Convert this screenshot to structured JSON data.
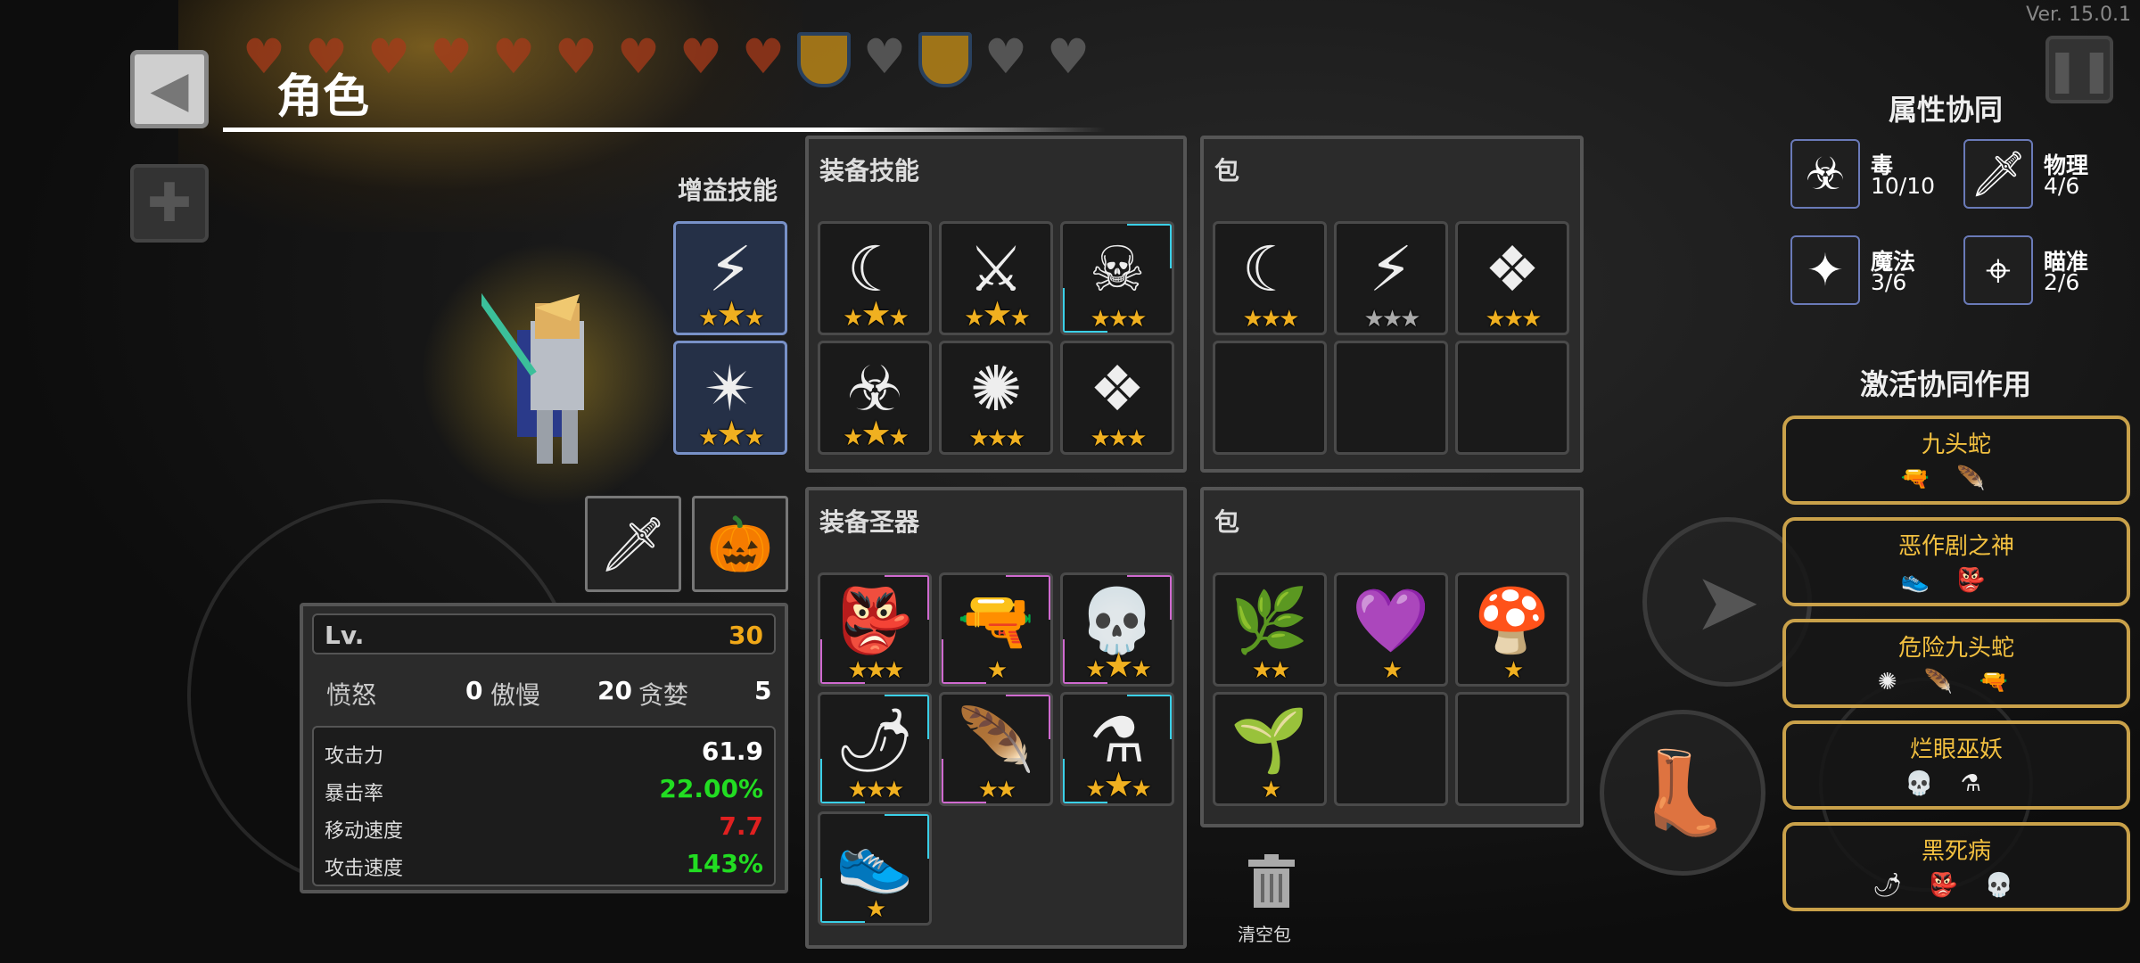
{
  "version": "Ver. 15.0.1",
  "hud": {
    "full_hearts": 9,
    "hearts": [
      "heart",
      "heart",
      "heart",
      "heart",
      "heart",
      "heart",
      "heart",
      "heart",
      "heart"
    ],
    "shields": [
      "shield",
      "armor",
      "shield",
      "armor",
      "armor"
    ]
  },
  "header": {
    "title": "角色",
    "back_icon": "◀",
    "add_icon": "✚"
  },
  "buff_skills": {
    "title": "增益技能",
    "slots": [
      {
        "icon": "boot-icon",
        "glyph": "⚡",
        "stars": 3,
        "big": 1
      },
      {
        "icon": "spiky-icon",
        "glyph": "✴",
        "stars": 3,
        "big": 1
      }
    ]
  },
  "equip_skills": {
    "title": "装备技能",
    "slots": [
      {
        "icon": "crescent-icon",
        "glyph": "☾",
        "stars": 3,
        "big": 1,
        "frame": ""
      },
      {
        "icon": "blade-icon",
        "glyph": "⚔",
        "stars": 3,
        "big": 1,
        "frame": ""
      },
      {
        "icon": "skull-icon",
        "glyph": "☠",
        "stars": 3,
        "big": 0,
        "frame": "cyan"
      },
      {
        "icon": "biohazard-icon",
        "glyph": "☣",
        "stars": 3,
        "big": 1,
        "frame": ""
      },
      {
        "icon": "burst-icon",
        "glyph": "✺",
        "stars": 3,
        "big": 0,
        "frame": ""
      },
      {
        "icon": "shards-icon",
        "glyph": "❖",
        "stars": 3,
        "big": 0,
        "frame": ""
      }
    ]
  },
  "bag_skills": {
    "title": "包",
    "slots": [
      {
        "icon": "crescent-icon",
        "glyph": "☾",
        "stars": 3,
        "grey": 0
      },
      {
        "icon": "boot-icon",
        "glyph": "⚡",
        "stars": 3,
        "grey": 1
      },
      {
        "icon": "shards-icon",
        "glyph": "❖",
        "stars": 3,
        "grey": 0
      },
      {
        "icon": "",
        "glyph": "",
        "stars": 0
      },
      {
        "icon": "",
        "glyph": "",
        "stars": 0
      },
      {
        "icon": "",
        "glyph": "",
        "stars": 0
      }
    ]
  },
  "equip_relics": {
    "title": "装备圣器",
    "slots": [
      {
        "icon": "mask-icon",
        "glyph": "👺",
        "stars": 3,
        "big": 0,
        "frame": "pink"
      },
      {
        "icon": "gun-icon",
        "glyph": "🔫",
        "stars": 1,
        "big": 0,
        "frame": "pink"
      },
      {
        "icon": "skull-relic-icon",
        "glyph": "💀",
        "stars": 3,
        "big": 1,
        "frame": "pink"
      },
      {
        "icon": "flame-plant-icon",
        "glyph": "🌶",
        "stars": 3,
        "big": 0,
        "frame": "cyan"
      },
      {
        "icon": "feather-icon",
        "glyph": "🪶",
        "stars": 2,
        "big": 0,
        "frame": "pink"
      },
      {
        "icon": "potion-icon",
        "glyph": "⚗",
        "stars": 3,
        "big": 1,
        "frame": "cyan"
      },
      {
        "icon": "sneaker-icon",
        "glyph": "👟",
        "stars": 1,
        "big": 0,
        "frame": "cyan"
      }
    ]
  },
  "bag_relics": {
    "title": "包",
    "slots": [
      {
        "icon": "root-icon",
        "glyph": "🌿",
        "stars": 2
      },
      {
        "icon": "crystal-icon",
        "glyph": "💜",
        "stars": 1
      },
      {
        "icon": "mushroom-icon",
        "glyph": "🍄",
        "stars": 1
      },
      {
        "icon": "herb-icon",
        "glyph": "🌱",
        "stars": 1
      },
      {
        "icon": "",
        "glyph": "",
        "stars": 0
      },
      {
        "icon": "",
        "glyph": "",
        "stars": 0
      }
    ]
  },
  "weapons": [
    {
      "icon": "sword-icon",
      "glyph": "🗡"
    },
    {
      "icon": "pumpkin-icon",
      "glyph": "🎃"
    }
  ],
  "stats": {
    "lv_label": "Lv.",
    "lv_value": "30",
    "sins": [
      {
        "label": "愤怒",
        "value": "0"
      },
      {
        "label": "傲慢",
        "value": "20"
      },
      {
        "label": "贪婪",
        "value": "5"
      }
    ],
    "rows": [
      {
        "label": "攻击力",
        "value": "61.9",
        "color": "#ffffff"
      },
      {
        "label": "暴击率",
        "value": "22.00%",
        "color": "#22dd22"
      },
      {
        "label": "移动速度",
        "value": "7.7",
        "color": "#e02020"
      },
      {
        "label": "攻击速度",
        "value": "143%",
        "color": "#22dd22"
      }
    ]
  },
  "synergy": {
    "title": "属性协同",
    "items": [
      {
        "name": "毒",
        "value": "10/10",
        "icon": "biohazard-icon",
        "glyph": "☣"
      },
      {
        "name": "物理",
        "value": "4/6",
        "icon": "sword-icon",
        "glyph": "🗡"
      },
      {
        "name": "魔法",
        "value": "3/6",
        "icon": "star4-icon",
        "glyph": "✦"
      },
      {
        "name": "瞄准",
        "value": "2/6",
        "icon": "crosshair-icon",
        "glyph": "⌖"
      }
    ],
    "active_title": "激活协同作用",
    "active": [
      {
        "name": "九头蛇",
        "icons": [
          "🔫",
          "🪶"
        ]
      },
      {
        "name": "恶作剧之神",
        "icons": [
          "👟",
          "👺"
        ]
      },
      {
        "name": "危险九头蛇",
        "icons": [
          "✺",
          "🪶",
          "🔫"
        ]
      },
      {
        "name": "烂眼巫妖",
        "icons": [
          "💀",
          "⚗"
        ]
      },
      {
        "name": "黑死病",
        "icons": [
          "🌶",
          "👺",
          "💀"
        ]
      }
    ]
  },
  "trash": {
    "label": "清空包"
  },
  "colors": {
    "accent": "#f0a818",
    "pink": "#d06ad0",
    "cyan": "#3ad0e8",
    "gold": "#c9a14a"
  }
}
